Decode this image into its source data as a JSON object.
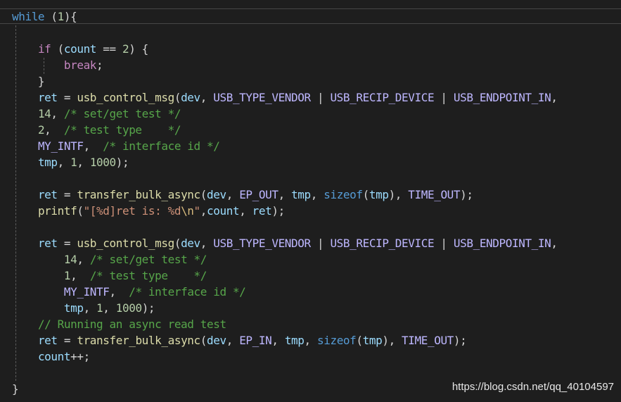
{
  "theme": {
    "background": "#1e1e1e",
    "keyword": "#569cd6",
    "control": "#c586c0",
    "function": "#dcdcaa",
    "variable": "#9cdcfe",
    "number": "#b5cea8",
    "comment": "#57a64a",
    "string": "#ce9178",
    "macro": "#beb7ff",
    "text": "#d4d4d4"
  },
  "code_lines": [
    [
      {
        "t": "kw",
        "v": "while"
      },
      {
        "t": "pun",
        "v": " ("
      },
      {
        "t": "num",
        "v": "1"
      },
      {
        "t": "pun",
        "v": "){"
      }
    ],
    [],
    [
      {
        "t": "pun",
        "v": "    "
      },
      {
        "t": "flow",
        "v": "if"
      },
      {
        "t": "pun",
        "v": " ("
      },
      {
        "t": "var",
        "v": "count"
      },
      {
        "t": "pun",
        "v": " == "
      },
      {
        "t": "num",
        "v": "2"
      },
      {
        "t": "pun",
        "v": ") {"
      }
    ],
    [
      {
        "t": "pun",
        "v": "        "
      },
      {
        "t": "flow",
        "v": "break"
      },
      {
        "t": "pun",
        "v": ";"
      }
    ],
    [
      {
        "t": "pun",
        "v": "    }"
      }
    ],
    [
      {
        "t": "pun",
        "v": "    "
      },
      {
        "t": "var",
        "v": "ret"
      },
      {
        "t": "pun",
        "v": " = "
      },
      {
        "t": "fn",
        "v": "usb_control_msg"
      },
      {
        "t": "pun",
        "v": "("
      },
      {
        "t": "var",
        "v": "dev"
      },
      {
        "t": "pun",
        "v": ", "
      },
      {
        "t": "mac",
        "v": "USB_TYPE_VENDOR"
      },
      {
        "t": "pun",
        "v": " | "
      },
      {
        "t": "mac",
        "v": "USB_RECIP_DEVICE"
      },
      {
        "t": "pun",
        "v": " | "
      },
      {
        "t": "mac",
        "v": "USB_ENDPOINT_IN"
      },
      {
        "t": "pun",
        "v": ","
      }
    ],
    [
      {
        "t": "pun",
        "v": "    "
      },
      {
        "t": "num",
        "v": "14"
      },
      {
        "t": "pun",
        "v": ", "
      },
      {
        "t": "cmt",
        "v": "/* set/get test */"
      }
    ],
    [
      {
        "t": "pun",
        "v": "    "
      },
      {
        "t": "num",
        "v": "2"
      },
      {
        "t": "pun",
        "v": ",  "
      },
      {
        "t": "cmt",
        "v": "/* test type    */"
      }
    ],
    [
      {
        "t": "pun",
        "v": "    "
      },
      {
        "t": "mac",
        "v": "MY_INTF"
      },
      {
        "t": "pun",
        "v": ",  "
      },
      {
        "t": "cmt",
        "v": "/* interface id */"
      }
    ],
    [
      {
        "t": "pun",
        "v": "    "
      },
      {
        "t": "var",
        "v": "tmp"
      },
      {
        "t": "pun",
        "v": ", "
      },
      {
        "t": "num",
        "v": "1"
      },
      {
        "t": "pun",
        "v": ", "
      },
      {
        "t": "num",
        "v": "1000"
      },
      {
        "t": "pun",
        "v": ");"
      }
    ],
    [],
    [
      {
        "t": "pun",
        "v": "    "
      },
      {
        "t": "var",
        "v": "ret"
      },
      {
        "t": "pun",
        "v": " = "
      },
      {
        "t": "fn",
        "v": "transfer_bulk_async"
      },
      {
        "t": "pun",
        "v": "("
      },
      {
        "t": "var",
        "v": "dev"
      },
      {
        "t": "pun",
        "v": ", "
      },
      {
        "t": "mac",
        "v": "EP_OUT"
      },
      {
        "t": "pun",
        "v": ", "
      },
      {
        "t": "var",
        "v": "tmp"
      },
      {
        "t": "pun",
        "v": ", "
      },
      {
        "t": "kw",
        "v": "sizeof"
      },
      {
        "t": "pun",
        "v": "("
      },
      {
        "t": "var",
        "v": "tmp"
      },
      {
        "t": "pun",
        "v": "), "
      },
      {
        "t": "mac",
        "v": "TIME_OUT"
      },
      {
        "t": "pun",
        "v": ");"
      }
    ],
    [
      {
        "t": "pun",
        "v": "    "
      },
      {
        "t": "fn",
        "v": "printf"
      },
      {
        "t": "pun",
        "v": "("
      },
      {
        "t": "str",
        "v": "\"[%d]ret is: %d"
      },
      {
        "t": "esc",
        "v": "\\n"
      },
      {
        "t": "str",
        "v": "\""
      },
      {
        "t": "pun",
        "v": ","
      },
      {
        "t": "var",
        "v": "count"
      },
      {
        "t": "pun",
        "v": ", "
      },
      {
        "t": "var",
        "v": "ret"
      },
      {
        "t": "pun",
        "v": ");"
      }
    ],
    [],
    [
      {
        "t": "pun",
        "v": "    "
      },
      {
        "t": "var",
        "v": "ret"
      },
      {
        "t": "pun",
        "v": " = "
      },
      {
        "t": "fn",
        "v": "usb_control_msg"
      },
      {
        "t": "pun",
        "v": "("
      },
      {
        "t": "var",
        "v": "dev"
      },
      {
        "t": "pun",
        "v": ", "
      },
      {
        "t": "mac",
        "v": "USB_TYPE_VENDOR"
      },
      {
        "t": "pun",
        "v": " | "
      },
      {
        "t": "mac",
        "v": "USB_RECIP_DEVICE"
      },
      {
        "t": "pun",
        "v": " | "
      },
      {
        "t": "mac",
        "v": "USB_ENDPOINT_IN"
      },
      {
        "t": "pun",
        "v": ","
      }
    ],
    [
      {
        "t": "pun",
        "v": "        "
      },
      {
        "t": "num",
        "v": "14"
      },
      {
        "t": "pun",
        "v": ", "
      },
      {
        "t": "cmt",
        "v": "/* set/get test */"
      }
    ],
    [
      {
        "t": "pun",
        "v": "        "
      },
      {
        "t": "num",
        "v": "1"
      },
      {
        "t": "pun",
        "v": ",  "
      },
      {
        "t": "cmt",
        "v": "/* test type    */"
      }
    ],
    [
      {
        "t": "pun",
        "v": "        "
      },
      {
        "t": "mac",
        "v": "MY_INTF"
      },
      {
        "t": "pun",
        "v": ",  "
      },
      {
        "t": "cmt",
        "v": "/* interface id */"
      }
    ],
    [
      {
        "t": "pun",
        "v": "        "
      },
      {
        "t": "var",
        "v": "tmp"
      },
      {
        "t": "pun",
        "v": ", "
      },
      {
        "t": "num",
        "v": "1"
      },
      {
        "t": "pun",
        "v": ", "
      },
      {
        "t": "num",
        "v": "1000"
      },
      {
        "t": "pun",
        "v": ");"
      }
    ],
    [
      {
        "t": "pun",
        "v": "    "
      },
      {
        "t": "cmt",
        "v": "// Running an async read test"
      }
    ],
    [
      {
        "t": "pun",
        "v": "    "
      },
      {
        "t": "var",
        "v": "ret"
      },
      {
        "t": "pun",
        "v": " = "
      },
      {
        "t": "fn",
        "v": "transfer_bulk_async"
      },
      {
        "t": "pun",
        "v": "("
      },
      {
        "t": "var",
        "v": "dev"
      },
      {
        "t": "pun",
        "v": ", "
      },
      {
        "t": "mac",
        "v": "EP_IN"
      },
      {
        "t": "pun",
        "v": ", "
      },
      {
        "t": "var",
        "v": "tmp"
      },
      {
        "t": "pun",
        "v": ", "
      },
      {
        "t": "kw",
        "v": "sizeof"
      },
      {
        "t": "pun",
        "v": "("
      },
      {
        "t": "var",
        "v": "tmp"
      },
      {
        "t": "pun",
        "v": "), "
      },
      {
        "t": "mac",
        "v": "TIME_OUT"
      },
      {
        "t": "pun",
        "v": ");"
      }
    ],
    [
      {
        "t": "pun",
        "v": "    "
      },
      {
        "t": "var",
        "v": "count"
      },
      {
        "t": "pun",
        "v": "++;"
      }
    ],
    [],
    [
      {
        "t": "pun",
        "v": "}"
      }
    ]
  ],
  "watermark": "https://blog.csdn.net/qq_40104597"
}
